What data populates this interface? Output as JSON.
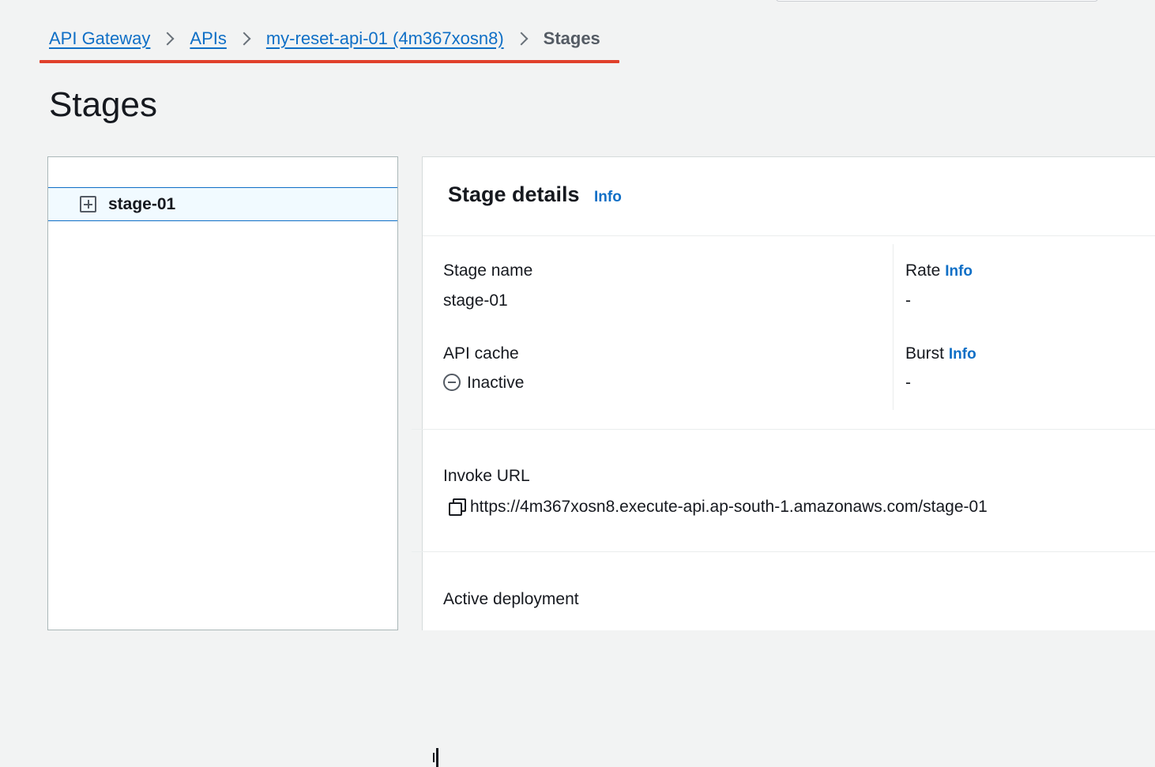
{
  "breadcrumb": {
    "items": [
      {
        "label": "API Gateway"
      },
      {
        "label": "APIs"
      },
      {
        "label": "my-reset-api-01 (4m367xosn8)"
      }
    ],
    "current": "Stages"
  },
  "page": {
    "title": "Stages"
  },
  "tree": {
    "items": [
      {
        "label": "stage-01",
        "icon": "expand-plus-icon"
      }
    ]
  },
  "details": {
    "title": "Stage details",
    "info_label": "Info",
    "stage_name": {
      "label": "Stage name",
      "value": "stage-01"
    },
    "api_cache": {
      "label": "API cache",
      "value": "Inactive",
      "icon": "inactive-minus-circle-icon"
    },
    "rate": {
      "label": "Rate",
      "info": "Info",
      "value": "-"
    },
    "burst": {
      "label": "Burst",
      "info": "Info",
      "value": "-"
    },
    "invoke_url": {
      "label": "Invoke URL",
      "value": "https://4m367xosn8.execute-api.ap-south-1.amazonaws.com/stage-01",
      "icon": "copy-icon"
    },
    "active_deployment": {
      "label": "Active deployment"
    }
  },
  "colors": {
    "link": "#0f6fc6",
    "highlight_underline": "#e0402b",
    "selected_row_bg": "#f1faff"
  }
}
